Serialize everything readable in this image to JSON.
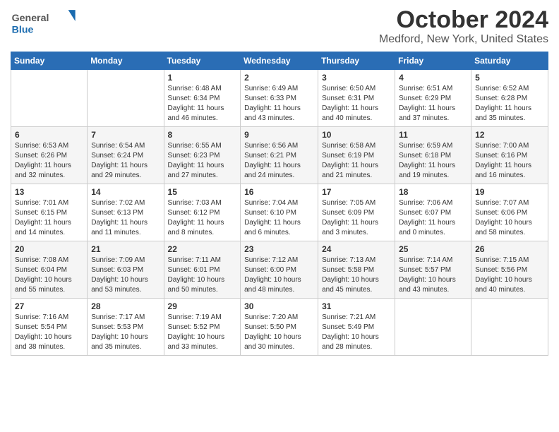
{
  "header": {
    "logo_general": "General",
    "logo_blue": "Blue",
    "month": "October 2024",
    "location": "Medford, New York, United States"
  },
  "weekdays": [
    "Sunday",
    "Monday",
    "Tuesday",
    "Wednesday",
    "Thursday",
    "Friday",
    "Saturday"
  ],
  "weeks": [
    [
      {
        "day": "",
        "sunrise": "",
        "sunset": "",
        "daylight": ""
      },
      {
        "day": "",
        "sunrise": "",
        "sunset": "",
        "daylight": ""
      },
      {
        "day": "1",
        "sunrise": "Sunrise: 6:48 AM",
        "sunset": "Sunset: 6:34 PM",
        "daylight": "Daylight: 11 hours and 46 minutes."
      },
      {
        "day": "2",
        "sunrise": "Sunrise: 6:49 AM",
        "sunset": "Sunset: 6:33 PM",
        "daylight": "Daylight: 11 hours and 43 minutes."
      },
      {
        "day": "3",
        "sunrise": "Sunrise: 6:50 AM",
        "sunset": "Sunset: 6:31 PM",
        "daylight": "Daylight: 11 hours and 40 minutes."
      },
      {
        "day": "4",
        "sunrise": "Sunrise: 6:51 AM",
        "sunset": "Sunset: 6:29 PM",
        "daylight": "Daylight: 11 hours and 37 minutes."
      },
      {
        "day": "5",
        "sunrise": "Sunrise: 6:52 AM",
        "sunset": "Sunset: 6:28 PM",
        "daylight": "Daylight: 11 hours and 35 minutes."
      }
    ],
    [
      {
        "day": "6",
        "sunrise": "Sunrise: 6:53 AM",
        "sunset": "Sunset: 6:26 PM",
        "daylight": "Daylight: 11 hours and 32 minutes."
      },
      {
        "day": "7",
        "sunrise": "Sunrise: 6:54 AM",
        "sunset": "Sunset: 6:24 PM",
        "daylight": "Daylight: 11 hours and 29 minutes."
      },
      {
        "day": "8",
        "sunrise": "Sunrise: 6:55 AM",
        "sunset": "Sunset: 6:23 PM",
        "daylight": "Daylight: 11 hours and 27 minutes."
      },
      {
        "day": "9",
        "sunrise": "Sunrise: 6:56 AM",
        "sunset": "Sunset: 6:21 PM",
        "daylight": "Daylight: 11 hours and 24 minutes."
      },
      {
        "day": "10",
        "sunrise": "Sunrise: 6:58 AM",
        "sunset": "Sunset: 6:19 PM",
        "daylight": "Daylight: 11 hours and 21 minutes."
      },
      {
        "day": "11",
        "sunrise": "Sunrise: 6:59 AM",
        "sunset": "Sunset: 6:18 PM",
        "daylight": "Daylight: 11 hours and 19 minutes."
      },
      {
        "day": "12",
        "sunrise": "Sunrise: 7:00 AM",
        "sunset": "Sunset: 6:16 PM",
        "daylight": "Daylight: 11 hours and 16 minutes."
      }
    ],
    [
      {
        "day": "13",
        "sunrise": "Sunrise: 7:01 AM",
        "sunset": "Sunset: 6:15 PM",
        "daylight": "Daylight: 11 hours and 14 minutes."
      },
      {
        "day": "14",
        "sunrise": "Sunrise: 7:02 AM",
        "sunset": "Sunset: 6:13 PM",
        "daylight": "Daylight: 11 hours and 11 minutes."
      },
      {
        "day": "15",
        "sunrise": "Sunrise: 7:03 AM",
        "sunset": "Sunset: 6:12 PM",
        "daylight": "Daylight: 11 hours and 8 minutes."
      },
      {
        "day": "16",
        "sunrise": "Sunrise: 7:04 AM",
        "sunset": "Sunset: 6:10 PM",
        "daylight": "Daylight: 11 hours and 6 minutes."
      },
      {
        "day": "17",
        "sunrise": "Sunrise: 7:05 AM",
        "sunset": "Sunset: 6:09 PM",
        "daylight": "Daylight: 11 hours and 3 minutes."
      },
      {
        "day": "18",
        "sunrise": "Sunrise: 7:06 AM",
        "sunset": "Sunset: 6:07 PM",
        "daylight": "Daylight: 11 hours and 0 minutes."
      },
      {
        "day": "19",
        "sunrise": "Sunrise: 7:07 AM",
        "sunset": "Sunset: 6:06 PM",
        "daylight": "Daylight: 10 hours and 58 minutes."
      }
    ],
    [
      {
        "day": "20",
        "sunrise": "Sunrise: 7:08 AM",
        "sunset": "Sunset: 6:04 PM",
        "daylight": "Daylight: 10 hours and 55 minutes."
      },
      {
        "day": "21",
        "sunrise": "Sunrise: 7:09 AM",
        "sunset": "Sunset: 6:03 PM",
        "daylight": "Daylight: 10 hours and 53 minutes."
      },
      {
        "day": "22",
        "sunrise": "Sunrise: 7:11 AM",
        "sunset": "Sunset: 6:01 PM",
        "daylight": "Daylight: 10 hours and 50 minutes."
      },
      {
        "day": "23",
        "sunrise": "Sunrise: 7:12 AM",
        "sunset": "Sunset: 6:00 PM",
        "daylight": "Daylight: 10 hours and 48 minutes."
      },
      {
        "day": "24",
        "sunrise": "Sunrise: 7:13 AM",
        "sunset": "Sunset: 5:58 PM",
        "daylight": "Daylight: 10 hours and 45 minutes."
      },
      {
        "day": "25",
        "sunrise": "Sunrise: 7:14 AM",
        "sunset": "Sunset: 5:57 PM",
        "daylight": "Daylight: 10 hours and 43 minutes."
      },
      {
        "day": "26",
        "sunrise": "Sunrise: 7:15 AM",
        "sunset": "Sunset: 5:56 PM",
        "daylight": "Daylight: 10 hours and 40 minutes."
      }
    ],
    [
      {
        "day": "27",
        "sunrise": "Sunrise: 7:16 AM",
        "sunset": "Sunset: 5:54 PM",
        "daylight": "Daylight: 10 hours and 38 minutes."
      },
      {
        "day": "28",
        "sunrise": "Sunrise: 7:17 AM",
        "sunset": "Sunset: 5:53 PM",
        "daylight": "Daylight: 10 hours and 35 minutes."
      },
      {
        "day": "29",
        "sunrise": "Sunrise: 7:19 AM",
        "sunset": "Sunset: 5:52 PM",
        "daylight": "Daylight: 10 hours and 33 minutes."
      },
      {
        "day": "30",
        "sunrise": "Sunrise: 7:20 AM",
        "sunset": "Sunset: 5:50 PM",
        "daylight": "Daylight: 10 hours and 30 minutes."
      },
      {
        "day": "31",
        "sunrise": "Sunrise: 7:21 AM",
        "sunset": "Sunset: 5:49 PM",
        "daylight": "Daylight: 10 hours and 28 minutes."
      },
      {
        "day": "",
        "sunrise": "",
        "sunset": "",
        "daylight": ""
      },
      {
        "day": "",
        "sunrise": "",
        "sunset": "",
        "daylight": ""
      }
    ]
  ]
}
